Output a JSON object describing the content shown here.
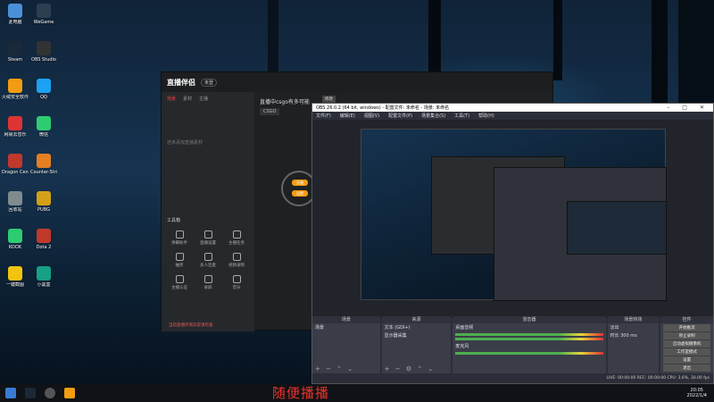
{
  "desktop_icons": [
    {
      "label": "此电脑",
      "color": "#4a90d9"
    },
    {
      "label": "Steam",
      "color": "#1b2838"
    },
    {
      "label": "火绒安全软件",
      "color": "#f39c12"
    },
    {
      "label": "网易云音乐",
      "color": "#d33"
    },
    {
      "label": "Dragon Center",
      "color": "#c0392b"
    },
    {
      "label": "回收站",
      "color": "#7f8c8d"
    },
    {
      "label": "KOOK",
      "color": "#2ecc71"
    },
    {
      "label": "一键截图",
      "color": "#f1c40f"
    },
    {
      "label": "WeGame",
      "color": "#2c3e50"
    },
    {
      "label": "OBS Studio",
      "color": "#333"
    },
    {
      "label": "QQ",
      "color": "#1da1f2"
    },
    {
      "label": "微信",
      "color": "#2ecc71"
    },
    {
      "label": "Counter-Strike",
      "color": "#e67e22"
    },
    {
      "label": "PUBG",
      "color": "#d4a017"
    },
    {
      "label": "Dota 2",
      "color": "#c0392b"
    },
    {
      "label": "小黑盒",
      "color": "#16a085"
    }
  ],
  "companion": {
    "app_name": "直播伴侣",
    "badge": "未登",
    "tabs": [
      "场景",
      "素材",
      "主播"
    ],
    "empty_hint": "还未添加直播素材",
    "tools_title": "工具箱",
    "tools": [
      "弹幕助手",
      "直播设置",
      "主播任务",
      "抽奖",
      "多人连麦",
      "视频录制",
      "主播认证",
      "录屏",
      "音乐"
    ],
    "warning": "当前直播环境异常请检查",
    "game_title": "直播中csgo有多可能",
    "edit": "修改",
    "category": "CSGO",
    "pills": [
      "开播",
      "设置"
    ]
  },
  "obs": {
    "title": "OBS 26.0.2 (64 bit, windows) - 配置文件: 未命名 - 场景: 未命名",
    "menu": [
      "文件(F)",
      "编辑(E)",
      "视图(V)",
      "配置文件(P)",
      "场景集合(S)",
      "工具(T)",
      "帮助(H)"
    ],
    "docks": {
      "scenes": {
        "title": "场景",
        "items": [
          "场景"
        ]
      },
      "sources": {
        "title": "来源",
        "items": [
          "文本 (GDI+)",
          "显示器采集"
        ]
      },
      "mixer": {
        "title": "混音器",
        "items": [
          "桌面音频",
          "麦克风"
        ],
        "levels_db": [
          -0.0,
          0.0
        ]
      },
      "transitions": {
        "title": "场景转场",
        "items": [
          "淡出",
          "时长 300 ms"
        ]
      },
      "controls": {
        "title": "控件",
        "items": [
          "开始推流",
          "停止录制",
          "启动虚拟摄像机",
          "工作室模式",
          "设置",
          "退出"
        ]
      }
    },
    "status": "LIVE: 00:00:00  REC: 00:00:00  CPU: 3.6%, 30.00 fps"
  },
  "taskbar": {
    "clock_time": "20:05",
    "clock_date": "2022/1/4"
  },
  "subtitle": "随便播播"
}
